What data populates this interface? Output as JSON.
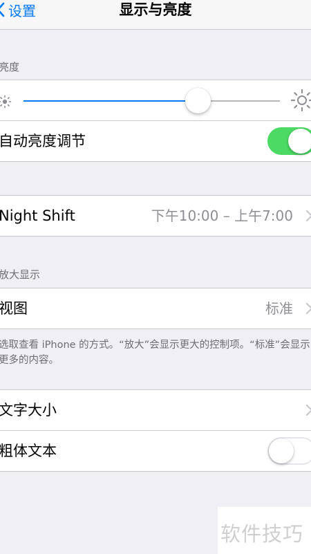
{
  "nav": {
    "back_label": "设置",
    "title": "显示与亮度"
  },
  "brightness": {
    "header": "亮度",
    "level": 0.68,
    "auto_label": "自动亮度调节",
    "auto_on": true
  },
  "night_shift": {
    "label": "Night Shift",
    "value": "下午10:00 – 上午7:00"
  },
  "zoom": {
    "header": "放大显示",
    "view_label": "视图",
    "view_value": "标准",
    "footer": "选取查看 iPhone 的方式。“放大”会显示更大的控制项。“标准”会显示更多的内容。"
  },
  "text": {
    "size_label": "文字大小",
    "bold_label": "粗体文本",
    "bold_on": false
  },
  "watermark": "软件技巧",
  "colors": {
    "accent": "#007aff",
    "toggle_on": "#4cd964",
    "background": "#efeff4"
  }
}
